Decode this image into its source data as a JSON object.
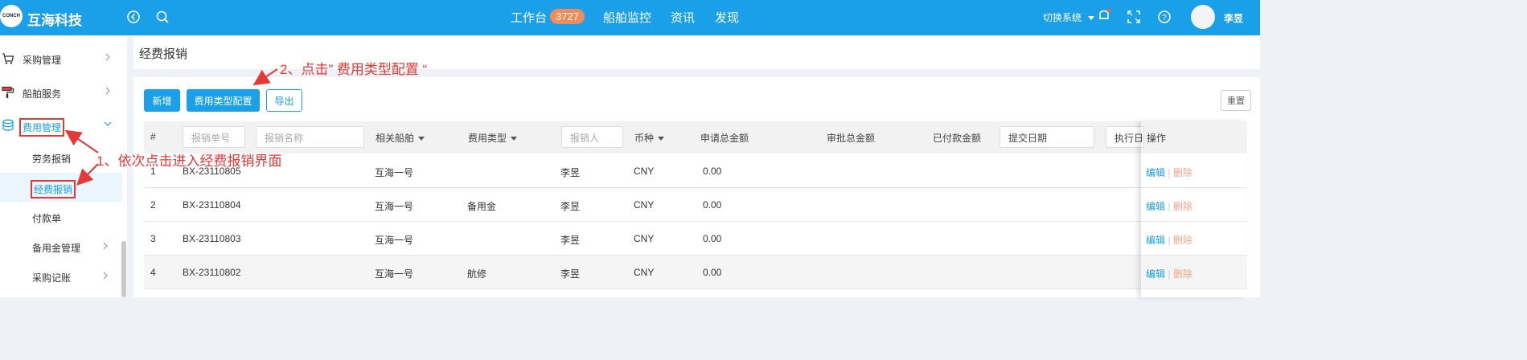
{
  "header": {
    "logo_text": "CONCH",
    "brand": "互海科技",
    "nav": [
      {
        "label": "工作台"
      },
      {
        "label": "船舶监控"
      },
      {
        "label": "资讯"
      },
      {
        "label": "发现"
      }
    ],
    "workbench_badge": "3727",
    "switch_label": "切换系统",
    "user_name": "李昱"
  },
  "sidebar": {
    "items": [
      {
        "label": "采购管理"
      },
      {
        "label": "船舶服务"
      },
      {
        "label": "费用管理"
      }
    ],
    "sub_items": [
      {
        "label": "劳务报销"
      },
      {
        "label": "经费报销"
      },
      {
        "label": "付款单"
      },
      {
        "label": "备用金管理"
      },
      {
        "label": "采购记账"
      }
    ]
  },
  "page": {
    "title": "经费报销"
  },
  "toolbar": {
    "add_label": "新增",
    "config_label": "费用类型配置",
    "export_label": "导出",
    "reset_label": "重置"
  },
  "annotations": {
    "step1": "1、依次点击进入经费报销界面",
    "step2": "2、点击” 费用类型配置 “"
  },
  "table": {
    "headers": {
      "index": "#",
      "no_placeholder": "报销单号",
      "name_placeholder": "报销名称",
      "ship": "相关船舶",
      "fee_type": "费用类型",
      "person_placeholder": "报销人",
      "currency": "币种",
      "apply_total": "申请总金额",
      "approve_total": "审批总金额",
      "paid_total": "已付款金额",
      "submit_date_placeholder": "提交日期",
      "exec_date_placeholder": "执行日",
      "ops": "操作"
    },
    "rows": [
      {
        "index": "1",
        "no": "BX-23110805",
        "ship": "互海一号",
        "fee_type": "",
        "person": "李昱",
        "currency": "CNY",
        "apply_total": "0.00"
      },
      {
        "index": "2",
        "no": "BX-23110804",
        "ship": "互海一号",
        "fee_type": "备用金",
        "person": "李昱",
        "currency": "CNY",
        "apply_total": "0.00"
      },
      {
        "index": "3",
        "no": "BX-23110803",
        "ship": "互海一号",
        "fee_type": "",
        "person": "李昱",
        "currency": "CNY",
        "apply_total": "0.00"
      },
      {
        "index": "4",
        "no": "BX-23110802",
        "ship": "互海一号",
        "fee_type": "航修",
        "person": "李昱",
        "currency": "CNY",
        "apply_total": "0.00"
      }
    ],
    "edit_label": "编辑",
    "delete_label": "删除"
  }
}
